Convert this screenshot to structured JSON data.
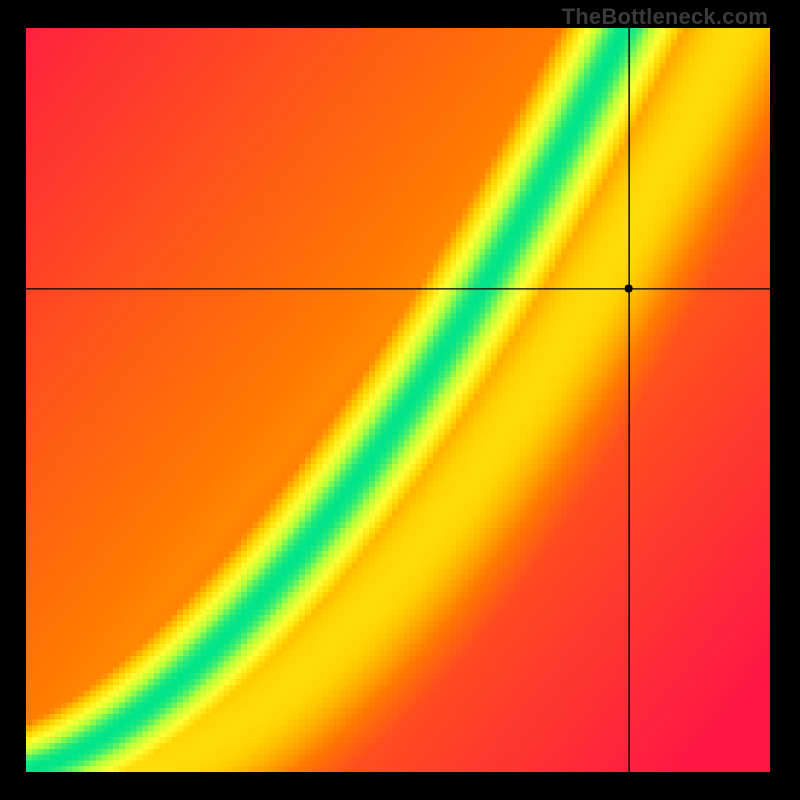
{
  "watermark": "TheBottleneck.com",
  "chart_data": {
    "type": "heatmap",
    "title": "",
    "xlabel": "",
    "ylabel": "",
    "xlim": [
      0,
      100
    ],
    "ylim": [
      0,
      100
    ],
    "grid": false,
    "legend_position": "none",
    "marker": {
      "x": 81,
      "y": 65,
      "radius": 4,
      "color": "#000000"
    },
    "crosshair": {
      "x": 81,
      "y": 65,
      "color": "#000000"
    },
    "ideal_curve_description": "nonlinear curve from bottom-left to top-right where green band indicates balanced match",
    "color_scale": {
      "0.00": "#ff1744",
      "0.35": "#ff7a00",
      "0.55": "#ffd400",
      "0.72": "#ffff33",
      "0.86": "#b6ff3a",
      "1.00": "#00e48a"
    },
    "ideal_curve_samples": [
      {
        "x": 0,
        "y": 0
      },
      {
        "x": 5,
        "y": 4
      },
      {
        "x": 10,
        "y": 8
      },
      {
        "x": 15,
        "y": 12
      },
      {
        "x": 20,
        "y": 17
      },
      {
        "x": 25,
        "y": 22
      },
      {
        "x": 30,
        "y": 28
      },
      {
        "x": 35,
        "y": 35
      },
      {
        "x": 40,
        "y": 43
      },
      {
        "x": 45,
        "y": 51
      },
      {
        "x": 50,
        "y": 59
      },
      {
        "x": 55,
        "y": 67
      },
      {
        "x": 60,
        "y": 76
      },
      {
        "x": 65,
        "y": 86
      },
      {
        "x": 70,
        "y": 95
      },
      {
        "x": 75,
        "y": 100
      }
    ],
    "secondary_band_note": "faint lighter ridge to the right of the main green curve"
  },
  "canvas": {
    "size": 128,
    "display": 744
  }
}
